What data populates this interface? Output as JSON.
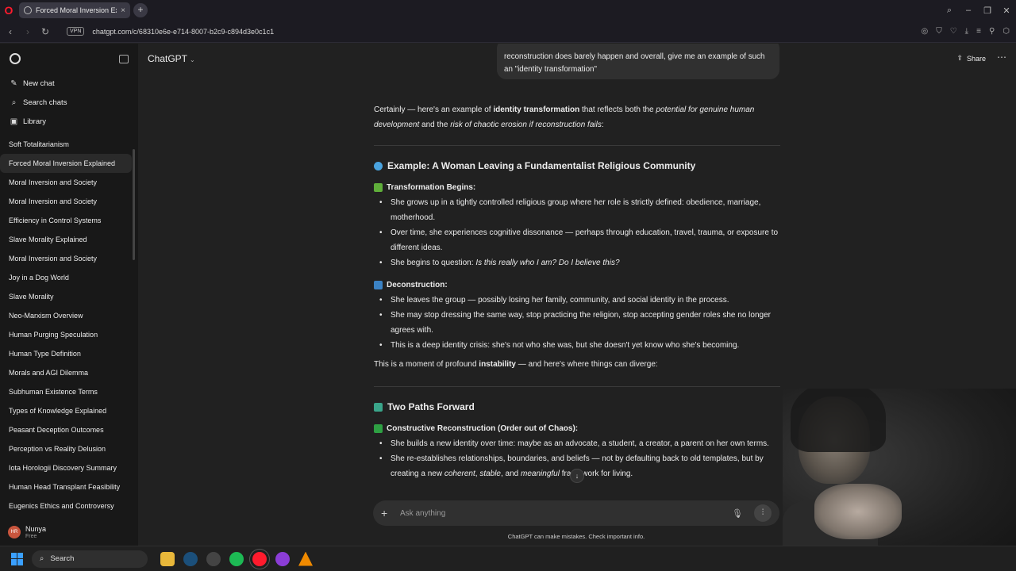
{
  "browser": {
    "tab_title": "Forced Moral Inversion Ex",
    "url": "chatgpt.com/c/68310e6e-e714-8007-b2c9-c894d3e0c1c1",
    "vpn_label": "VPN"
  },
  "sidebar": {
    "actions": [
      {
        "label": "New chat",
        "icon": "pencil-icon"
      },
      {
        "label": "Search chats",
        "icon": "search-icon"
      },
      {
        "label": "Library",
        "icon": "library-icon"
      }
    ],
    "chats": [
      "Soft Totalitarianism",
      "Forced Moral Inversion Explained",
      "Moral Inversion and Society",
      "Moral Inversion and Society",
      "Efficiency in Control Systems",
      "Slave Morality Explained",
      "Moral Inversion and Society",
      "Joy in a Dog World",
      "Slave Morality",
      "Neo-Marxism Overview",
      "Human Purging Speculation",
      "Human Type Definition",
      "Morals and AGI Dilemma",
      "Subhuman Existence Terms",
      "Types of Knowledge Explained",
      "Peasant Deception Outcomes",
      "Perception vs Reality Delusion",
      "Iota Horologii Discovery Summary",
      "Human Head Transplant Feasibility",
      "Eugenics Ethics and Controversy"
    ],
    "active_index": 1,
    "user": {
      "initials": "HR",
      "name": "Nunya",
      "plan": "Free"
    }
  },
  "header": {
    "model": "ChatGPT",
    "share_label": "Share"
  },
  "user_message": "reconstruction does barely happen and overall, give me an example of such an \"identity transformation\"",
  "response": {
    "intro_pre": "Certainly — here's an example of ",
    "intro_bold": "identity transformation",
    "intro_mid": " that reflects both the ",
    "intro_i1": "potential for genuine human development",
    "intro_and": " and the ",
    "intro_i2": "risk of chaotic erosion if reconstruction fails",
    "intro_end": ":",
    "example_heading": "Example: A Woman Leaving a Fundamentalist Religious Community",
    "s1_title": "Transformation Begins:",
    "s1_b1": "She grows up in a tightly controlled religious group where her role is strictly defined: obedience, marriage, motherhood.",
    "s1_b2": "Over time, she experiences cognitive dissonance — perhaps through education, travel, trauma, or exposure to different ideas.",
    "s1_b3_pre": "She begins to question: ",
    "s1_b3_i": "Is this really who I am? Do I believe this?",
    "s2_title": "Deconstruction:",
    "s2_b1": "She leaves the group — possibly losing her family, community, and social identity in the process.",
    "s2_b2": "She may stop dressing the same way, stop practicing the religion, stop accepting gender roles she no longer agrees with.",
    "s2_b3": "This is a deep identity crisis: she's not who she was, but she doesn't yet know who she's becoming.",
    "p_pre": "This is a moment of profound ",
    "p_bold": "instability",
    "p_post": " — and here's where things can diverge:",
    "paths_heading": "Two Paths Forward",
    "s3_title": "Constructive Reconstruction (Order out of Chaos):",
    "s3_b1": "She builds a new identity over time: maybe as an advocate, a student, a creator, a parent on her own terms.",
    "s3_b2_pre": "She re-establishes relationships, boundaries, and beliefs — not by defaulting back to old templates, but by creating a new ",
    "s3_b2_i1": "coherent",
    "s3_b2_c": ", ",
    "s3_b2_i2": "stable",
    "s3_b2_and": ", and ",
    "s3_b2_i3": "meaningful",
    "s3_b2_post": " framework for living."
  },
  "composer": {
    "placeholder": "Ask anything",
    "disclaimer": "ChatGPT can make mistakes. Check important info."
  },
  "taskbar": {
    "search_label": "Search"
  },
  "colors": {
    "accent_green": "#2ea043",
    "accent_blue": "#3aa0ff",
    "opera_red": "#ff1b2d"
  }
}
